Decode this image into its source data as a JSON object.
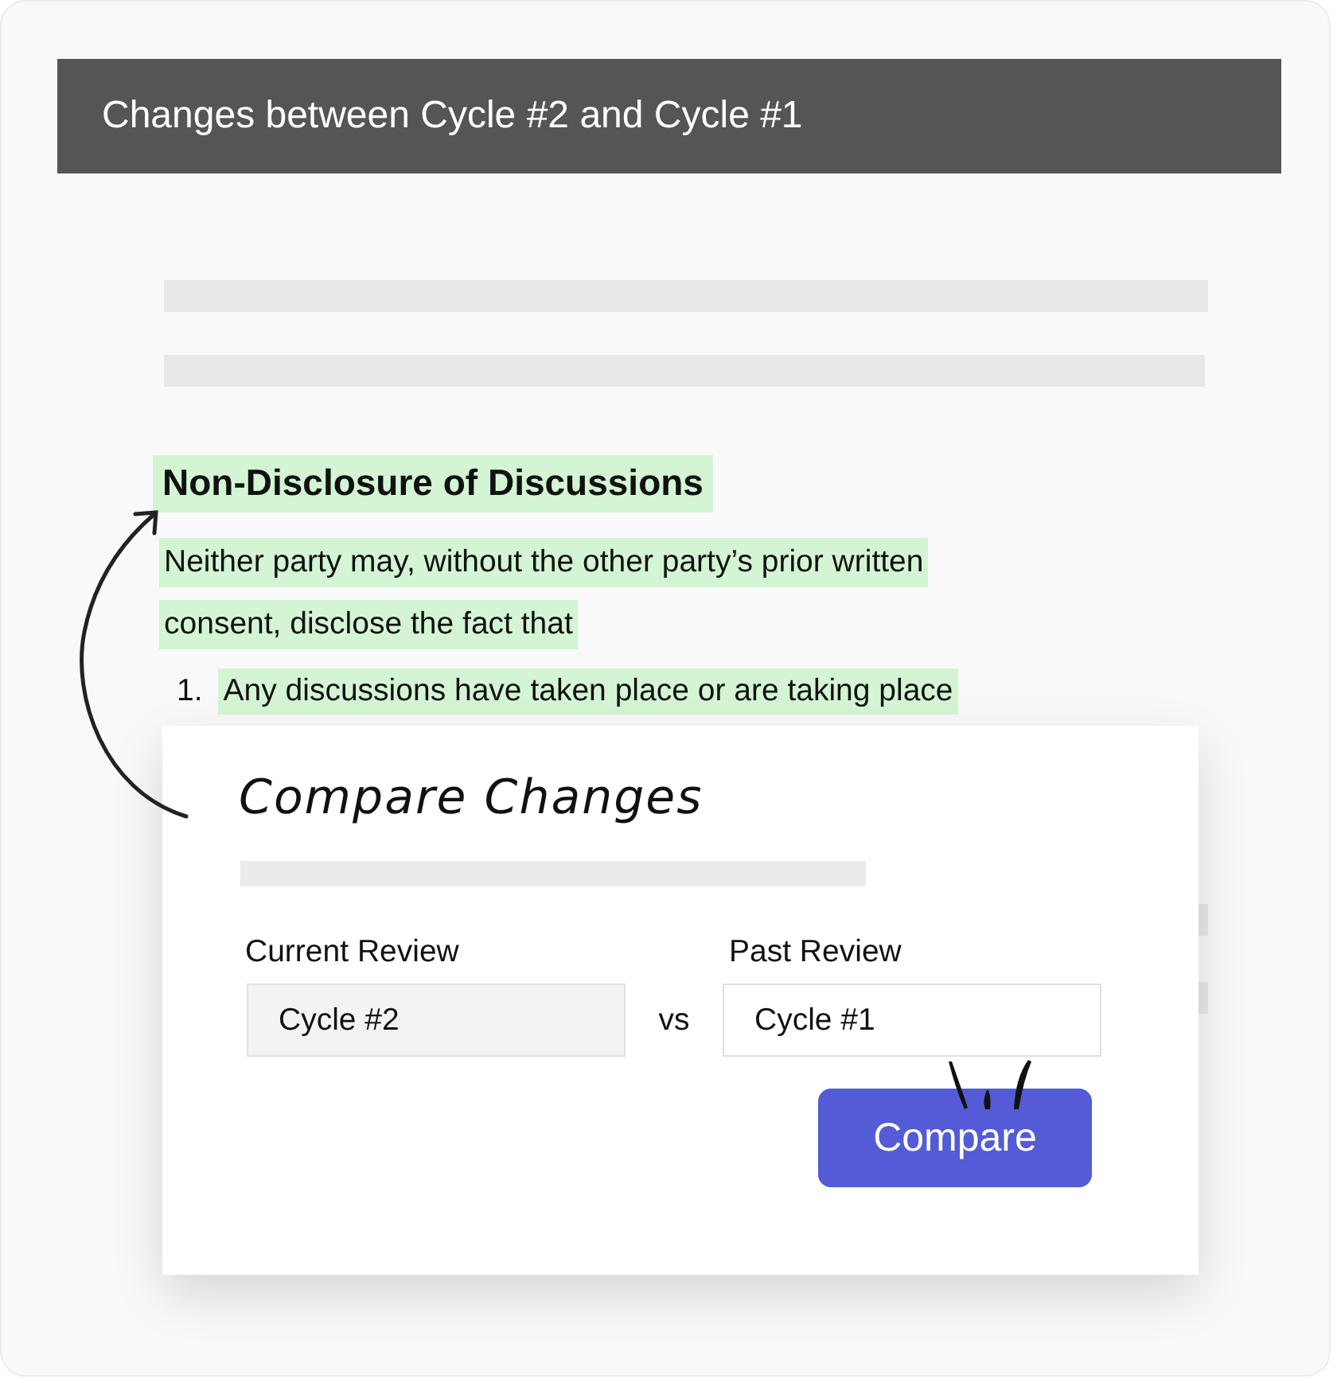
{
  "header": {
    "title": "Changes between Cycle #2 and Cycle #1"
  },
  "document": {
    "heading": "Non-Disclosure of Discussions",
    "paragraph_lines": [
      "Neither party may, without the other party’s prior written",
      "consent, disclose the fact that"
    ],
    "list": [
      {
        "number": "1.",
        "text": "Any discussions have taken place or are taking place"
      }
    ]
  },
  "dialog": {
    "title": "Compare Changes",
    "separator": "vs",
    "button": "Compare",
    "fields": [
      {
        "label": "Current Review",
        "value": "Cycle #2",
        "disabled": true
      },
      {
        "label": "Past Review",
        "value": "Cycle #1",
        "disabled": false
      }
    ]
  }
}
